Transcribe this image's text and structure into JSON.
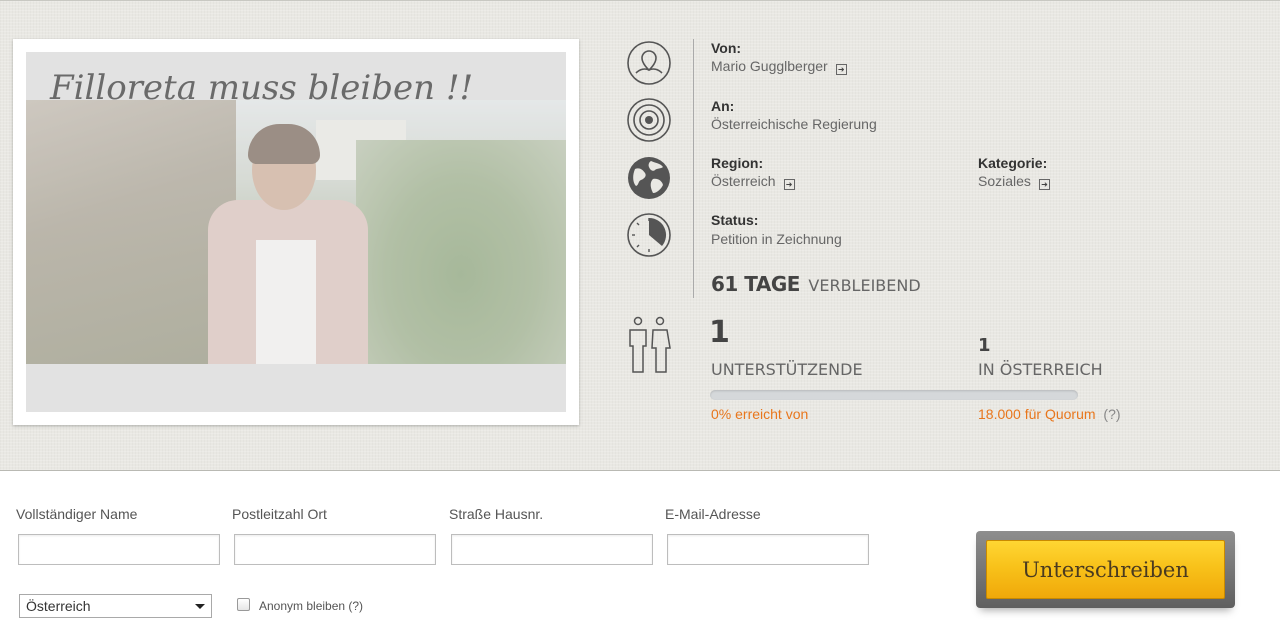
{
  "petition": {
    "title": "Filloreta muss bleiben !!"
  },
  "info": {
    "from_label": "Von:",
    "from_value": "Mario Gugglberger",
    "to_label": "An:",
    "to_value": "Österreichische Regierung",
    "region_label": "Region:",
    "region_value": "Österreich",
    "category_label": "Kategorie:",
    "category_value": "Soziales",
    "status_label": "Status:",
    "status_value": "Petition in Zeichnung",
    "days_number": "61 TAGE",
    "days_text": "VERBLEIBEND"
  },
  "counts": {
    "supporters_number": "1",
    "supporters_caption": "UNTERSTÜTZENDE",
    "austria_number": "1",
    "austria_caption": "IN ÖSTERREICH",
    "progress_fraction": 0.0,
    "reached_text": "0% erreicht von",
    "quorum_number": "18.000",
    "quorum_text": "für Quorum",
    "quorum_help": "(?)"
  },
  "form": {
    "name_label": "Vollständiger Name",
    "zip_label": "Postleitzahl Ort",
    "street_label": "Straße Hausnr.",
    "email_label": "E-Mail-Adresse",
    "name_value": "",
    "zip_value": "",
    "street_value": "",
    "email_value": "",
    "country_selected": "Österreich",
    "anonymous_label": "Anonym bleiben (?)",
    "anonymous_checked": false,
    "sign_button": "Unterschreiben"
  },
  "icons": {
    "from": "person-pin-icon",
    "to": "target-icon",
    "region": "globe-icon",
    "status": "clock-icon",
    "supporters": "people-icon"
  },
  "colors": {
    "accent": "#e8761c",
    "button": "#f8c21a"
  }
}
